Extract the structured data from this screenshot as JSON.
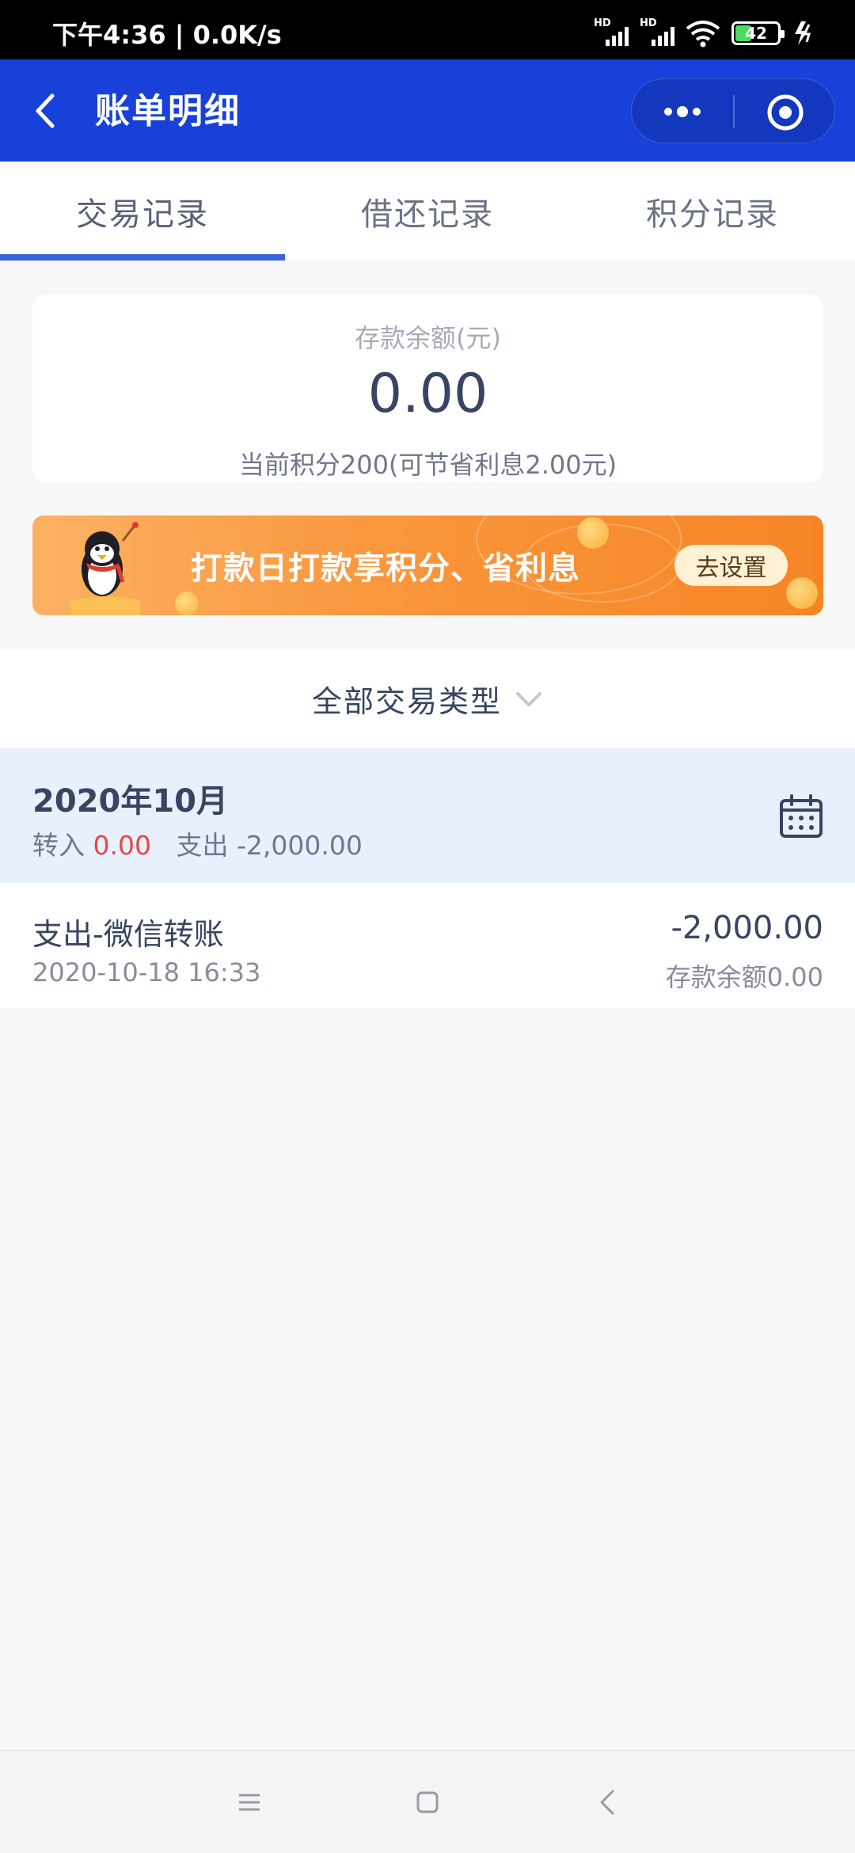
{
  "status_bar": {
    "time": "下午4:36 | 0.0K/s",
    "signal_label": "HD",
    "battery": "42"
  },
  "header": {
    "title": "账单明细"
  },
  "tabs": [
    {
      "label": "交易记录",
      "active": true
    },
    {
      "label": "借还记录",
      "active": false
    },
    {
      "label": "积分记录",
      "active": false
    }
  ],
  "balance": {
    "label": "存款余额(元)",
    "value": "0.00",
    "note": "当前积分200(可节省利息2.00元)"
  },
  "banner": {
    "text": "打款日打款享积分、省利息",
    "button": "去设置"
  },
  "filter": {
    "label": "全部交易类型"
  },
  "month": {
    "title": "2020年10月",
    "in_label": "转入",
    "in_value": "0.00",
    "out_label": "支出",
    "out_value": "-2,000.00"
  },
  "transactions": [
    {
      "title": "支出-微信转账",
      "date": "2020-10-18 16:33",
      "amount": "-2,000.00",
      "balance": "存款余额0.00"
    }
  ],
  "colors": {
    "header_blue": "#1741d8",
    "tab_indicator": "#3b64db",
    "income_red": "#e34848",
    "banner_orange": "#fa963c"
  }
}
